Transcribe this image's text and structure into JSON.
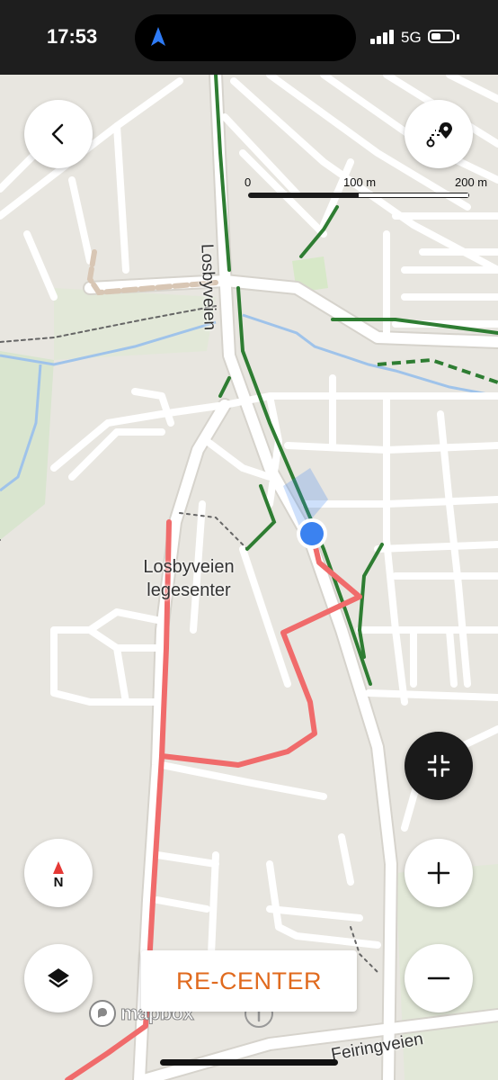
{
  "status_bar": {
    "time": "17:53",
    "network": "5G",
    "icons": [
      "navigation-arrow-icon",
      "cellular-signal-icon",
      "battery-icon"
    ]
  },
  "map": {
    "scale": {
      "labels": [
        "0",
        "100 m",
        "200 m"
      ]
    },
    "place_label": "Losbyveien\nlegesenter",
    "streets": [
      "Losbyveien",
      "Feiringveien"
    ],
    "attribution": "mapbox",
    "route_color": "#f06b6b",
    "trail_color": "#2e7d32",
    "water_color": "#9fc3ea",
    "location_color": "#3b82f0"
  },
  "controls": {
    "back_icon": "chevron-left-icon",
    "route_icon": "route-pin-icon",
    "compass_label": "N",
    "collapse_icon": "collapse-icon",
    "zoom_in_icon": "plus-icon",
    "zoom_out_icon": "minus-icon",
    "layers_icon": "layers-icon",
    "info_icon": "info-icon",
    "recenter_label": "RE-CENTER"
  }
}
